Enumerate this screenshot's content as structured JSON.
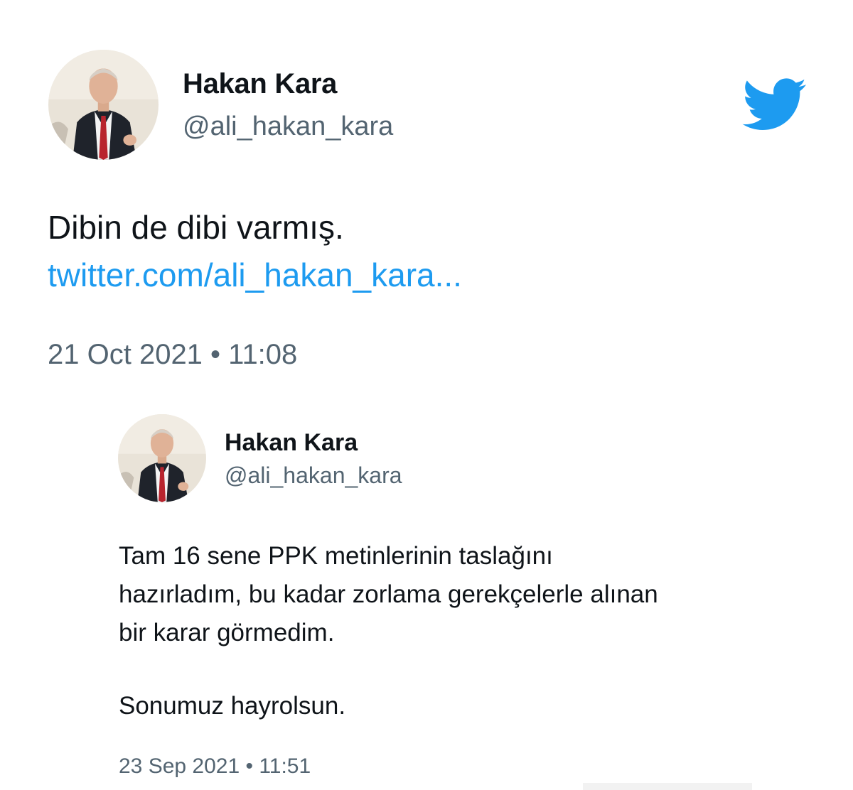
{
  "main_tweet": {
    "author_name": "Hakan Kara",
    "author_handle": "@ali_hakan_kara",
    "text": "Dibin de dibi varmış.",
    "link": "twitter.com/ali_hakan_kara...",
    "timestamp": "21 Oct 2021 • 11:08"
  },
  "quoted_tweet": {
    "author_name": "Hakan Kara",
    "author_handle": "@ali_hakan_kara",
    "paragraph_1_lines": [
      "Tam 16 sene PPK metinlerinin taslağını",
      "hazırladım, bu kadar zorlama gerekçelerle alınan",
      "bir karar görmedim."
    ],
    "paragraph_2": "Sonumuz hayrolsun.",
    "timestamp": "23 Sep 2021 • 11:51"
  },
  "icons": {
    "brand_logo": "twitter-bird-icon",
    "avatar": "profile-photo"
  },
  "colors": {
    "brand_blue": "#1d9bf0",
    "link_blue": "#1d9bf0",
    "secondary_text": "#536471",
    "primary_text": "#0f1419",
    "background": "#ffffff"
  }
}
